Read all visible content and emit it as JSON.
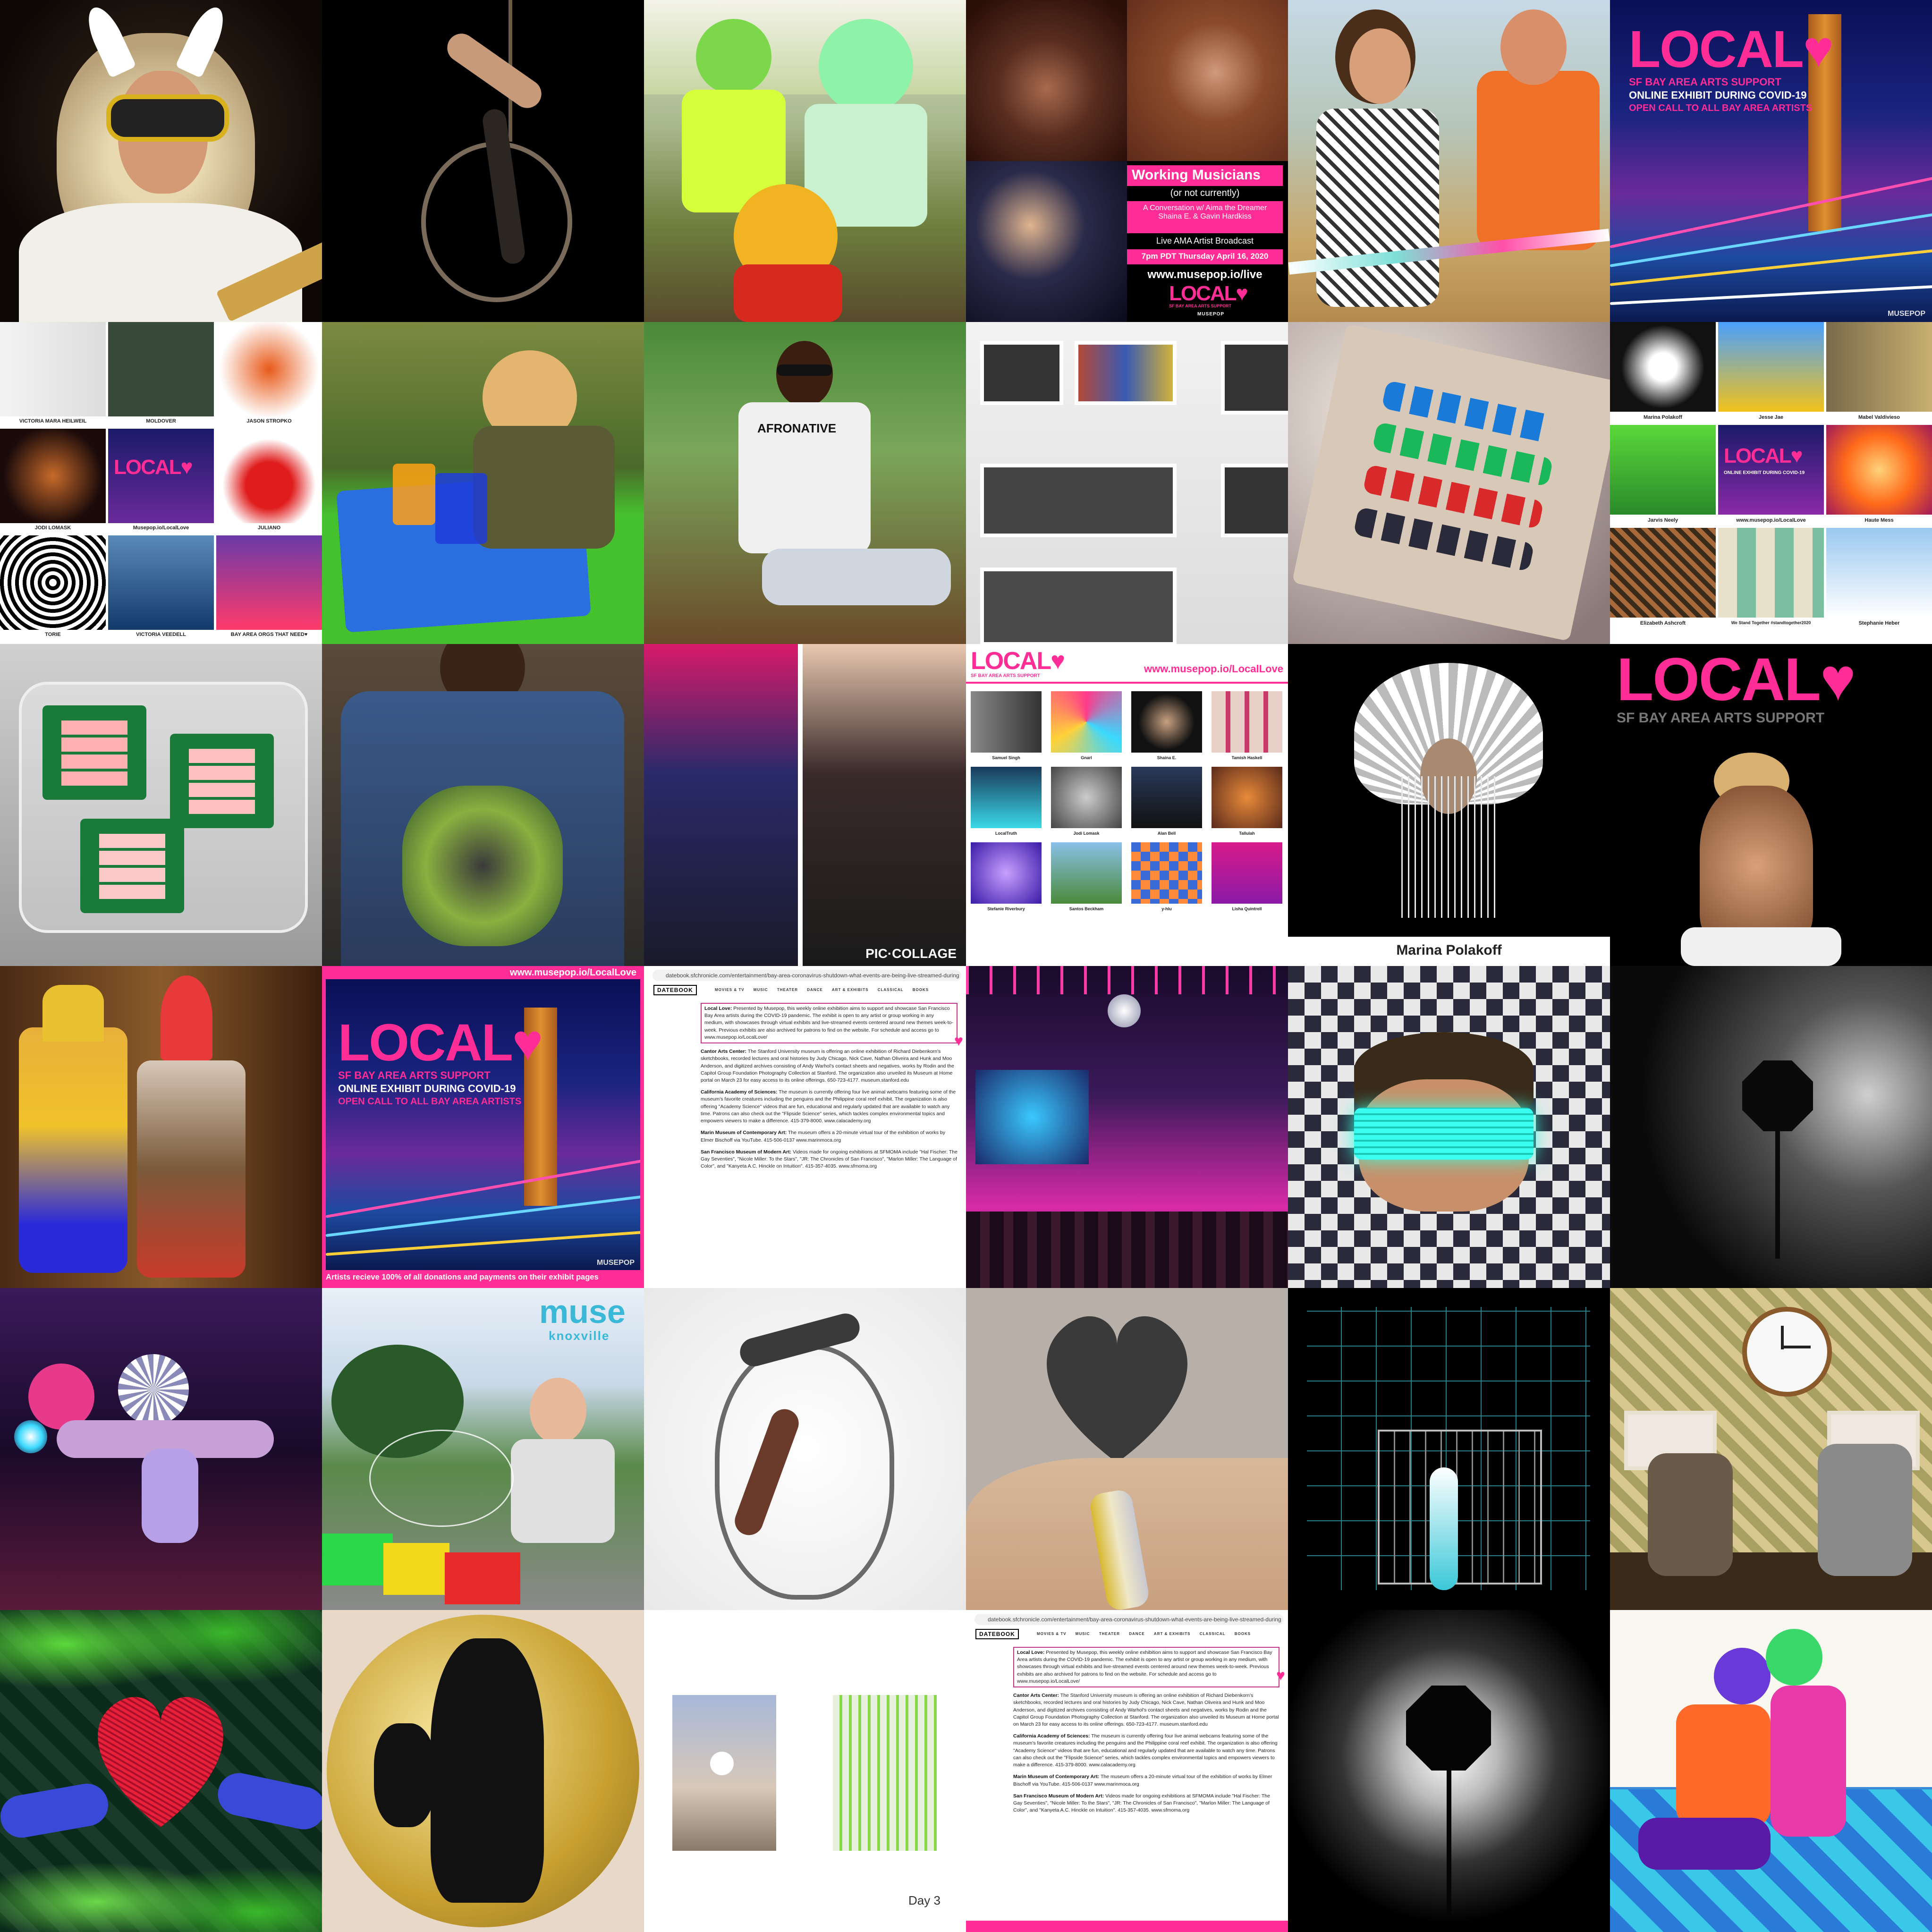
{
  "tiles": {
    "t04": {
      "title": "Working Musicians",
      "subtitle": "(or not currently)",
      "line1": "A Conversation w/ Aima the Dreamer",
      "line2": "Shaina E. & Gavin Hardkiss",
      "line3": "Live AMA Artist Broadcast",
      "line4": "7pm PDT Thursday April 16, 2020",
      "url": "www.musepop.io/live",
      "logo": "LOCAL",
      "logo_sub": "SF BAY AREA ARTS SUPPORT",
      "brand": "MUSEPOP"
    },
    "t06": {
      "logo": "LOCAL",
      "sub1": "SF BAY AREA ARTS SUPPORT",
      "sub2": "ONLINE EXHIBIT DURING COVID-19",
      "sub3": "OPEN CALL TO ALL BAY AREA ARTISTS",
      "brand": "MUSEPOP"
    },
    "t07": {
      "captions": [
        "VICTORIA MARA HEILWEIL",
        "MOLDOVER",
        "JASON STROPKO",
        "JODI LOMASK",
        "Musepop.io/LocalLove",
        "JULIANO",
        "TORIE",
        "VICTORIA VEEDELL",
        "BAY AREA ORGS THAT NEED♥"
      ],
      "logo": "LOCAL"
    },
    "t09": {
      "shirt": "AFRONATIVE"
    },
    "t12": {
      "captions": [
        "Marina Polakoff",
        "Jesse Jae",
        "Mabel Valdivieso",
        "Jarvis Neely",
        "www.musepop.io/LocalLove",
        "Haute Mess",
        "Elizabeth Ashcroft",
        "We Stand Together #standtogether2020",
        "Stephanie Heber"
      ],
      "logo": "LOCAL",
      "logo_sub": "ONLINE EXHIBIT DURING COVID-19"
    },
    "t15": {
      "watermark": "PIC·COLLAGE"
    },
    "t16": {
      "logo": "LOCAL",
      "logo_sub": "SF BAY AREA ARTS SUPPORT",
      "url": "www.musepop.io/LocalLove",
      "captions": [
        "Samuel Singh",
        "Gnarl",
        "Shaina E.",
        "Tamish Haskell",
        "LocalTruth",
        "Jodi Lomask",
        "Alan Bell",
        "Tallulah",
        "Stefanie Riverbury",
        "Santos Beckham",
        "y-hlu",
        "Lisha Quintrell"
      ]
    },
    "t17": {
      "caption": "Marina Polakoff"
    },
    "t18": {
      "logo": "LOCAL",
      "logo_sub": "SF BAY AREA ARTS SUPPORT"
    },
    "t20": {
      "url": "www.musepop.io/LocalLove",
      "logo": "LOCAL",
      "sub1": "SF BAY AREA ARTS SUPPORT",
      "sub2": "ONLINE EXHIBIT DURING COVID-19",
      "sub3": "OPEN CALL TO ALL BAY AREA ARTISTS",
      "footer": "Artists recieve 100% of all donations and payments on their exhibit pages",
      "brand": "MUSEPOP"
    },
    "article": {
      "url": "datebook.sfchronicle.com/entertainment/bay-area-coronavirus-shutdown-what-events-are-being-live-streamed-during",
      "datebook": "DATEBOOK",
      "tabs": [
        "MOVIES & TV",
        "MUSIC",
        "THEATER",
        "DANCE",
        "ART & EXHIBITS",
        "CLASSICAL",
        "BOOKS"
      ],
      "p1_lead": "Local Love:",
      "p1": "Presented by Musepop, this weekly online exhibition aims to support and showcase San Francisco Bay Area artists during the COVID-19 pandemic. The exhibit is open to any artist or group working in any medium, with showcases through virtual exhibits and live-streamed events centered around new themes week-to-week. Previous exhibits are also archived for patrons to find on the website. For schedule and access go to www.musepop.io/LocalLove/",
      "p2_lead": "Cantor Arts Center:",
      "p2": "The Stanford University museum is offering an online exhibition of Richard Diebenkorn's sketchbooks, recorded lectures and oral histories by Judy Chicago, Nick Cave, Nathan Oliveira and Hunk and Moo Anderson, and digitized archives consisting of Andy Warhol's contact sheets and negatives, works by Rodin and the Capitol Group Foundation Photography Collection at Stanford. The organization also unveiled its Museum at Home portal on March 23 for easy access to its online offerings. 650-723-4177. museum.stanford.edu",
      "p3_lead": "California Academy of Sciences:",
      "p3": "The museum is currently offering four live animal webcams featuring some of the museum's favorite creatures including the penguins and the Philippine coral reef exhibit. The organization is also offering \"Academy Science\" videos that are fun, educational and regularly updated that are available to watch any time. Patrons can also check out the \"Flipside Science\" series, which tackles complex environmental topics and empowers viewers to make a difference. 415-379-8000. www.calacademy.org",
      "p4_lead": "Marin Museum of Contemporary Art:",
      "p4": "The museum offers a 20-minute virtual tour of the exhibition of works by Elmer Bischoff via YouTube. 415-506-0137 www.marinmoca.org",
      "p5_lead": "San Francisco Museum of Modern Art:",
      "p5": "Videos made for ongoing exhibitions at SFMOMA include \"Hal Fischer: The Gay Seventies\", \"Nicole Miller: To the Stars\", \"JR: The Chronicles of San Francisco\", \"Marlon Miller: The Language of Color\", and \"Kanyeta A.C. Hinckle on Intuition\". 415-357-4035. www.sfmoma.org"
    },
    "t26": {
      "logo_main": "muse",
      "logo_sub": "knoxville"
    },
    "t33": {
      "caption": "Day 3"
    }
  }
}
